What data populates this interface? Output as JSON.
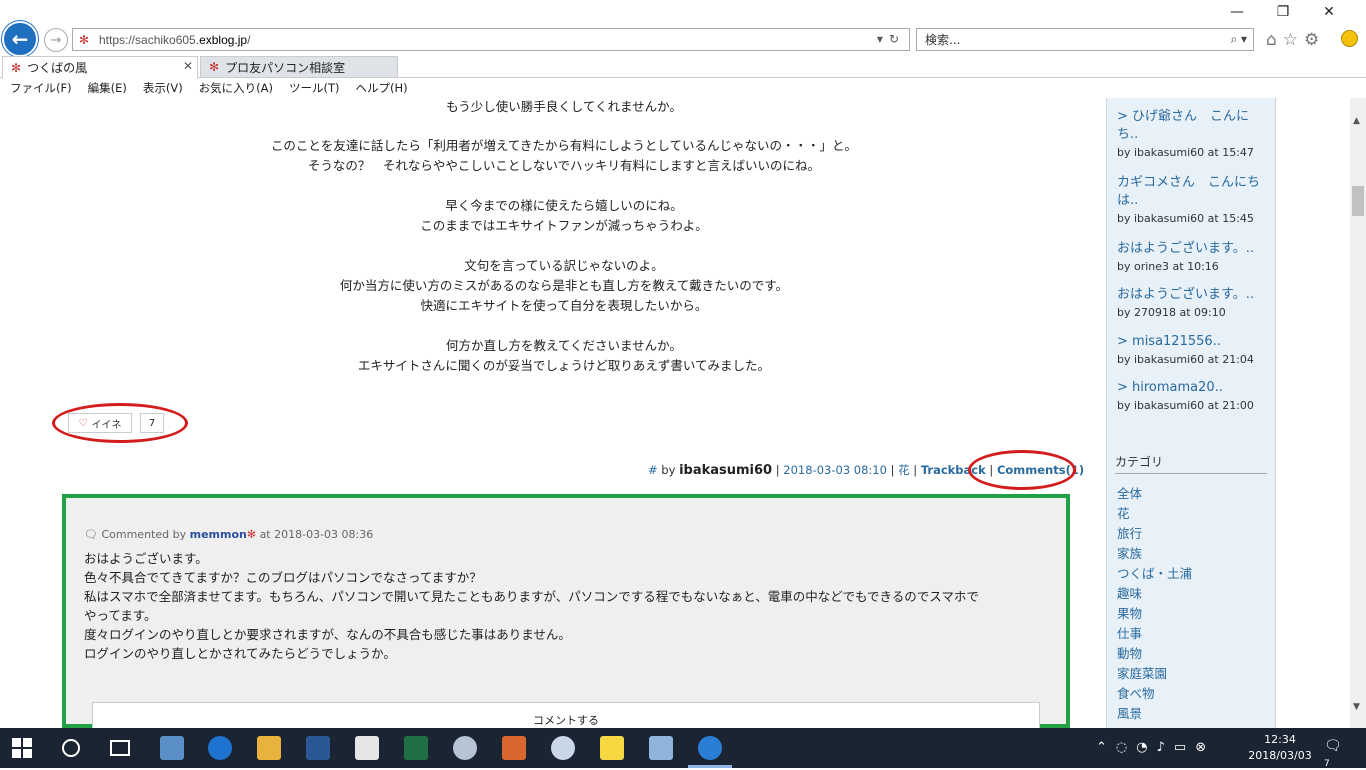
{
  "browser": {
    "url_prefix": "https://sachiko605.",
    "url_domain": "exblog.jp",
    "url_suffix": "/",
    "search_placeholder": "検索...",
    "tabs": [
      {
        "label": "つくばの風"
      },
      {
        "label": "プロ友パソコン相談室"
      }
    ],
    "menu": [
      "ファイル(F)",
      "編集(E)",
      "表示(V)",
      "お気に入り(A)",
      "ツール(T)",
      "ヘルプ(H)"
    ]
  },
  "post": {
    "lines": [
      "もう少し使い勝手良くしてくれませんか。",
      "このことを友達に話したら「利用者が増えてきたから有料にしようとしているんじゃないの・・・」と。",
      "そうなの？　それならややこしいことしないでハッキリ有料にしますと言えばいいのにね。",
      "早く今までの様に使えたら嬉しいのにね。",
      "このままではエキサイトファンが減っちゃうわよ。",
      "文句を言っている訳じゃないのよ。",
      "何か当方に使い方のミスがあるのなら是非とも直し方を教えて戴きたいのです。",
      "快適にエキサイトを使って自分を表現したいから。",
      "何方か直し方を教えてくださいませんか。",
      "エキサイトさんに聞くのが妥当でしょうけど取りあえず書いてみました。"
    ],
    "like_label": "イイネ",
    "like_count": "7",
    "meta": {
      "hash": "#",
      "by": "by",
      "author": "ibakasumi60",
      "datetime": "2018-03-03 08:10",
      "category": "花",
      "trackback": "Trackback",
      "comments": "Comments(1)"
    }
  },
  "comment": {
    "prefix": "Commented by",
    "author": "memmon",
    "at": "at 2018-03-03 08:36",
    "lines": [
      "おはようございます。",
      "色々不具合でてきてますか？このブログはパソコンでなさってますか？",
      "私はスマホで全部済ませてます。もちろん、パソコンで開いて見たこともありますが、パソコンでする程でもないなぁと、電車の中などでもできるのでスマホで",
      "やってます。",
      "度々ログインのやり直しとか要求されますが、なんの不具合も感じた事はありません。",
      "ログインのやり直しとかされてみたらどうでしょうか。"
    ],
    "button": "コメントする"
  },
  "sidebar": {
    "recent_comments": [
      {
        "title": "> ひげ爺さん　こんにち..",
        "sub": "by ibakasumi60 at 15:47"
      },
      {
        "title": "カギコメさん　こんにちは..",
        "sub": "by ibakasumi60 at 15:45"
      },
      {
        "title": "おはようございます。..",
        "sub": "by orine3 at 10:16"
      },
      {
        "title": "おはようございます。..",
        "sub": "by 270918 at 09:10"
      },
      {
        "title": "> misa121556..",
        "sub": "by ibakasumi60 at 21:04"
      },
      {
        "title": "> hiromama20..",
        "sub": "by ibakasumi60 at 21:00"
      }
    ],
    "category_heading": "カテゴリ",
    "categories": [
      "全体",
      "花",
      "旅行",
      "家族",
      "つくば・土浦",
      "趣味",
      "果物",
      "仕事",
      "動物",
      "家庭菜園",
      "食べ物",
      "風景"
    ]
  },
  "taskbar": {
    "time": "12:34",
    "date": "2018/03/03",
    "notifications": "7"
  },
  "colors": {
    "link": "#2a6a9e",
    "highlight_oval": "#d31c1c",
    "comment_frame": "#22a046",
    "taskbar": "#1b2433"
  }
}
